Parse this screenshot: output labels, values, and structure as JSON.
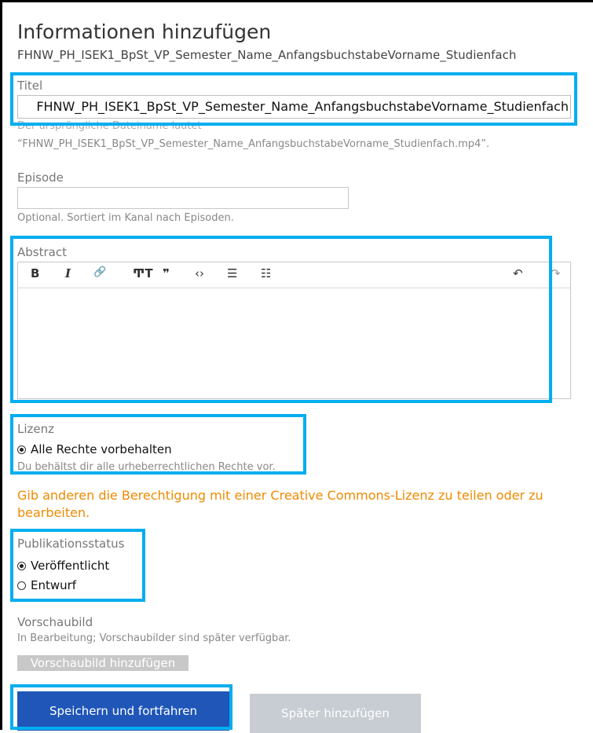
{
  "heading": {
    "title": "Informationen hinzufügen",
    "filename": "FHNW_PH_ISEK1_BpSt_VP_Semester_Name_AnfangsbuchstabeVorname_Studienfach"
  },
  "titel": {
    "label": "Titel",
    "value": "FHNW_PH_ISEK1_BpSt_VP_Semester_Name_AnfangsbuchstabeVorname_Studienfach",
    "hint_line1": "Der ursprüngliche Dateiname lautet",
    "hint_line2": "“FHNW_PH_ISEK1_BpSt_VP_Semester_Name_AnfangsbuchstabeVorname_Studienfach.mp4”."
  },
  "episode": {
    "label": "Episode",
    "value": "",
    "hint": "Optional. Sortiert im Kanal nach Episoden."
  },
  "abstract": {
    "label": "Abstract",
    "toolbar": {
      "bold": "B",
      "italic": "I",
      "link": "🔗",
      "text_size": "ͲT",
      "quote": "❞",
      "code": "‹›",
      "bullet_list": "☰",
      "numbered_list": "☷",
      "undo": "↶",
      "redo": "↷"
    },
    "value": ""
  },
  "lizenz": {
    "label": "Lizenz",
    "option": "Alle Rechte vorbehalten",
    "hint": "Du behältst dir alle urheberrechtlichen Rechte vor.",
    "cc_link": "Gib anderen die Berechtigung mit einer Creative Commons-Lizenz zu teilen oder zu bearbeiten."
  },
  "publikationsstatus": {
    "label": "Publikationsstatus",
    "options": [
      "Veröffentlicht",
      "Entwurf"
    ],
    "selected": "Veröffentlicht"
  },
  "vorschaubild": {
    "label": "Vorschaubild",
    "hint": "In Bearbeitung; Vorschaubilder sind später verfügbar.",
    "button": "Vorschaubild hinzufügen"
  },
  "actions": {
    "save": "Speichern und fortfahren",
    "later": "Später hinzufügen"
  },
  "colors": {
    "highlight": "#00aeef",
    "primary": "#1f56b8",
    "link": "#f08a00"
  }
}
